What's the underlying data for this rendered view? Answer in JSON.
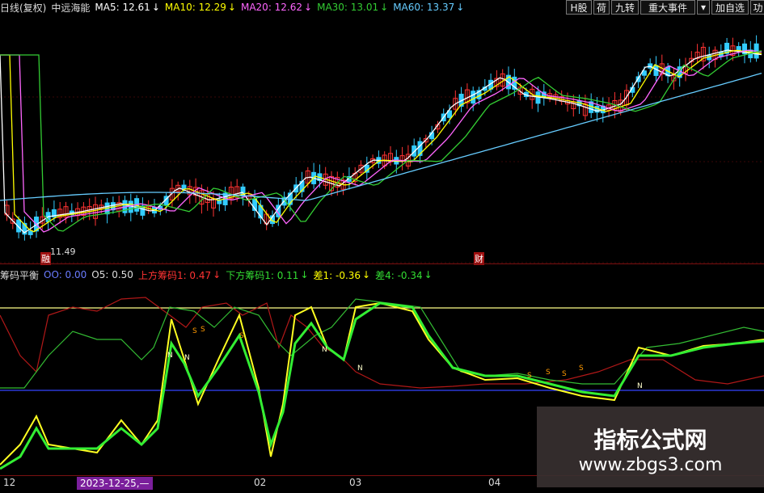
{
  "header": {
    "period": "日线(复权)",
    "stock": "中远海能",
    "ma": [
      {
        "label": "MA5: 12.61",
        "color": "#ffffff"
      },
      {
        "label": "MA10: 12.29",
        "color": "#ffff00"
      },
      {
        "label": "MA20: 12.62",
        "color": "#ff66ff"
      },
      {
        "label": "MA30: 13.01",
        "color": "#33cc33"
      },
      {
        "label": "MA60: 13.37",
        "color": "#66ccff"
      }
    ],
    "arrow": "↓",
    "buttons": [
      "H股",
      "荷",
      "九转",
      "重大事件",
      "▾",
      "加自选",
      "功"
    ]
  },
  "main": {
    "low_label": "11.49",
    "marker1": "融",
    "marker2": "财"
  },
  "indicator": {
    "name": "筹码平衡",
    "items": [
      {
        "label": "OO: 0.00",
        "color": "#6a7bff"
      },
      {
        "label": "O5: 0.50",
        "color": "#dddddd"
      },
      {
        "label": "上方筹码1: 0.47",
        "color": "#ff3333"
      },
      {
        "label": "下方筹码1: 0.11",
        "color": "#33dd33"
      },
      {
        "label": "差1: -0.36",
        "color": "#ffff00"
      },
      {
        "label": "差4: -0.34",
        "color": "#33dd33"
      }
    ],
    "marks": [
      "S",
      "S",
      "S",
      "S",
      "S",
      "S",
      "S",
      "N",
      "N",
      "N",
      "N",
      "N"
    ]
  },
  "xaxis": {
    "ticks": [
      "12",
      "02",
      "03",
      "04"
    ],
    "highlight": "2023-12-25,—"
  },
  "watermark": {
    "title": "指标公式网",
    "url": "www.zbgs3.com"
  },
  "colors": {
    "bg": "#000000",
    "up": "#ff3333",
    "down": "#33ccff",
    "hline_top": "#ffff88",
    "hline_bot": "#3344ff"
  }
}
